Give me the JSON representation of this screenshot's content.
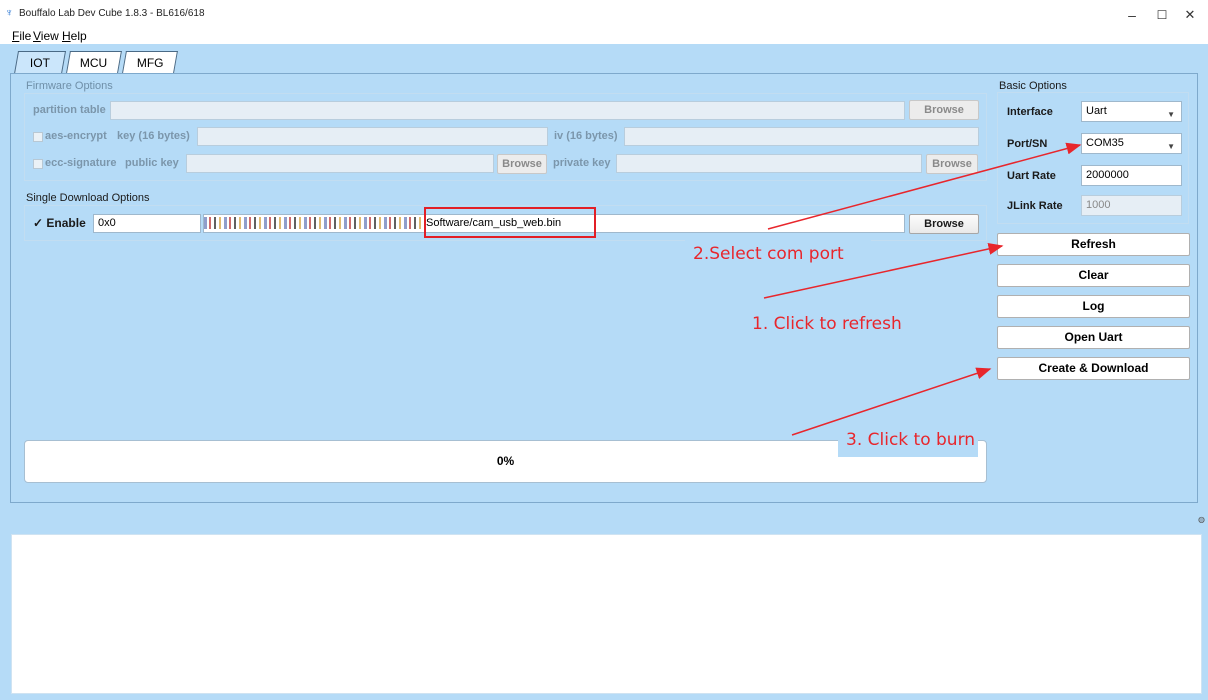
{
  "window": {
    "title": "Bouffalo Lab Dev Cube 1.8.3 - BL616/618",
    "controls": [
      "–",
      "☐",
      "✕"
    ]
  },
  "menu": [
    {
      "accel": "F",
      "rest": "ile"
    },
    {
      "accel": "V",
      "rest": "iew"
    },
    {
      "accel": "H",
      "rest": "elp"
    }
  ],
  "tabs": [
    "IOT",
    "MCU",
    "MFG"
  ],
  "firmware": {
    "title": "Firmware Options",
    "partition_label": "partition table",
    "browse": "Browse",
    "aes_label": "aes-encrypt",
    "key_label": "key (16 bytes)",
    "iv_label": "iv (16 bytes)",
    "ecc_label": "ecc-signature",
    "public_key_label": "public key",
    "private_key_label": "private key"
  },
  "single": {
    "title": "Single Download Options",
    "enable_label": "Enable",
    "enable_check": "✓",
    "address": "0x0",
    "path_visible": "Software/cam_usb_web.bin",
    "browse": "Browse"
  },
  "basic": {
    "title": "Basic Options",
    "interface_label": "Interface",
    "interface_value": "Uart",
    "port_label": "Port/SN",
    "port_value": "COM35",
    "uart_rate_label": "Uart Rate",
    "uart_rate_value": "2000000",
    "jlink_rate_label": "JLink Rate",
    "jlink_rate_value": "1000"
  },
  "actions": {
    "refresh": "Refresh",
    "clear": "Clear",
    "log": "Log",
    "open_uart": "Open Uart",
    "create_download": "Create & Download"
  },
  "progress": {
    "text": "0%",
    "value": 0
  },
  "annotations": {
    "step1": "1. Click to refresh",
    "step2": "2.Select com port",
    "step3": "3. Click to burn",
    "color": "#e8262c"
  }
}
